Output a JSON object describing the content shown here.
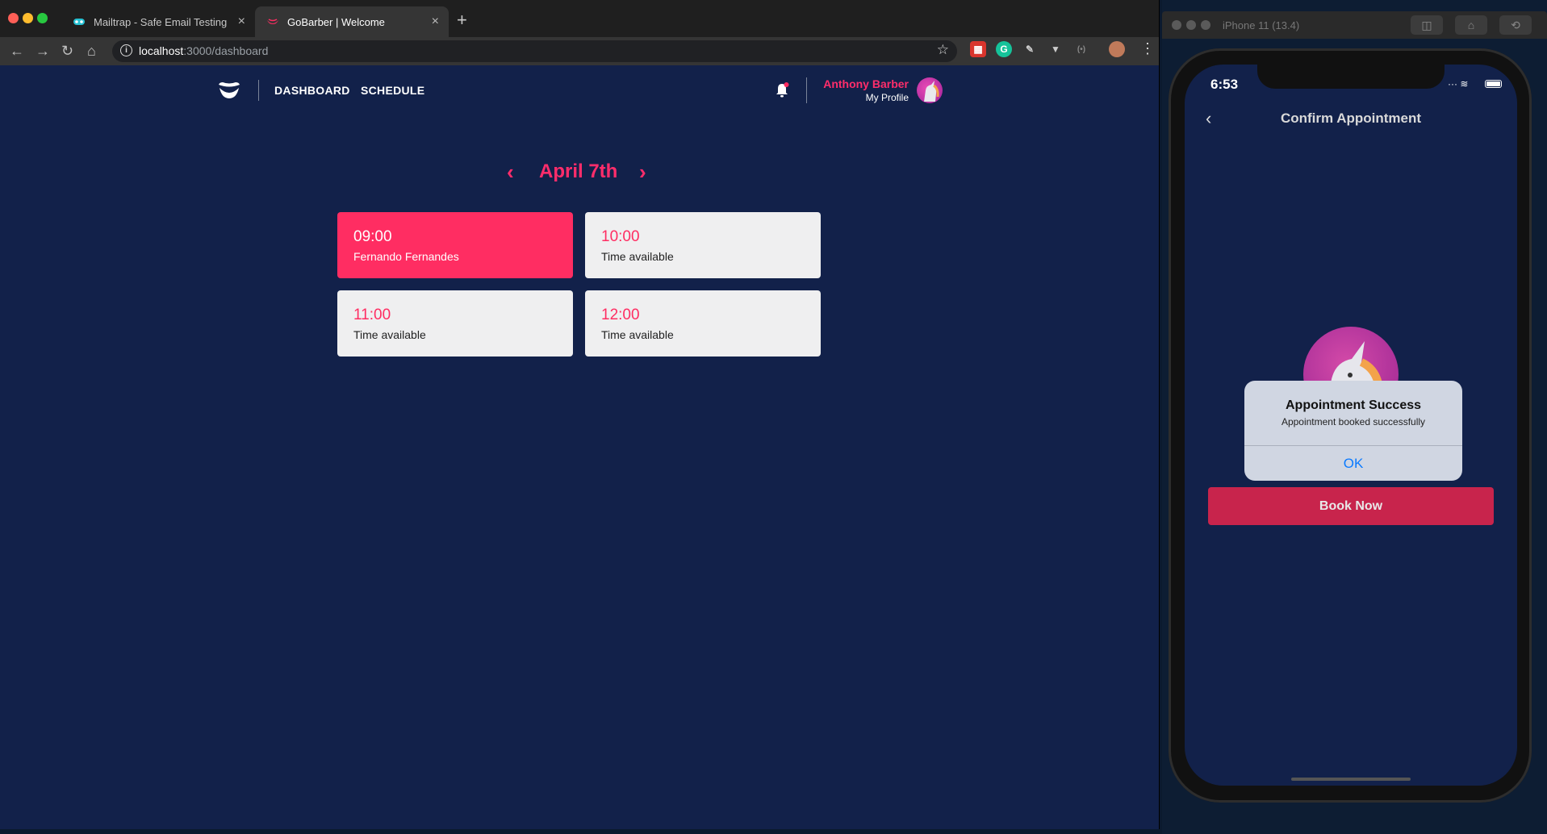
{
  "browser": {
    "tabs": [
      {
        "title": "Mailtrap - Safe Email Testing",
        "active": false
      },
      {
        "title": "GoBarber | Welcome",
        "active": true
      }
    ],
    "url_host": "localhost",
    "url_path": ":3000/dashboard"
  },
  "app": {
    "nav": {
      "dashboard": "DASHBOARD",
      "schedule": "SCHEDULE"
    },
    "profile": {
      "name": "Anthony Barber",
      "link": "My Profile"
    },
    "date_title": "April 7th",
    "slots": [
      {
        "time": "09:00",
        "label": "Fernando Fernandes",
        "booked": true
      },
      {
        "time": "10:00",
        "label": "Time available",
        "booked": false
      },
      {
        "time": "11:00",
        "label": "Time available",
        "booked": false
      },
      {
        "time": "12:00",
        "label": "Time available",
        "booked": false
      }
    ],
    "colors": {
      "accent": "#ff2d62",
      "background": "#12214a",
      "slot_bg": "#efeff0"
    }
  },
  "simulator": {
    "device_label": "iPhone 11 (13.4)",
    "time": "6:53",
    "screen_title": "Confirm Appointment",
    "alert": {
      "title": "Appointment Success",
      "message": "Appointment booked successfully",
      "ok": "OK"
    },
    "book_button": "Book Now"
  }
}
